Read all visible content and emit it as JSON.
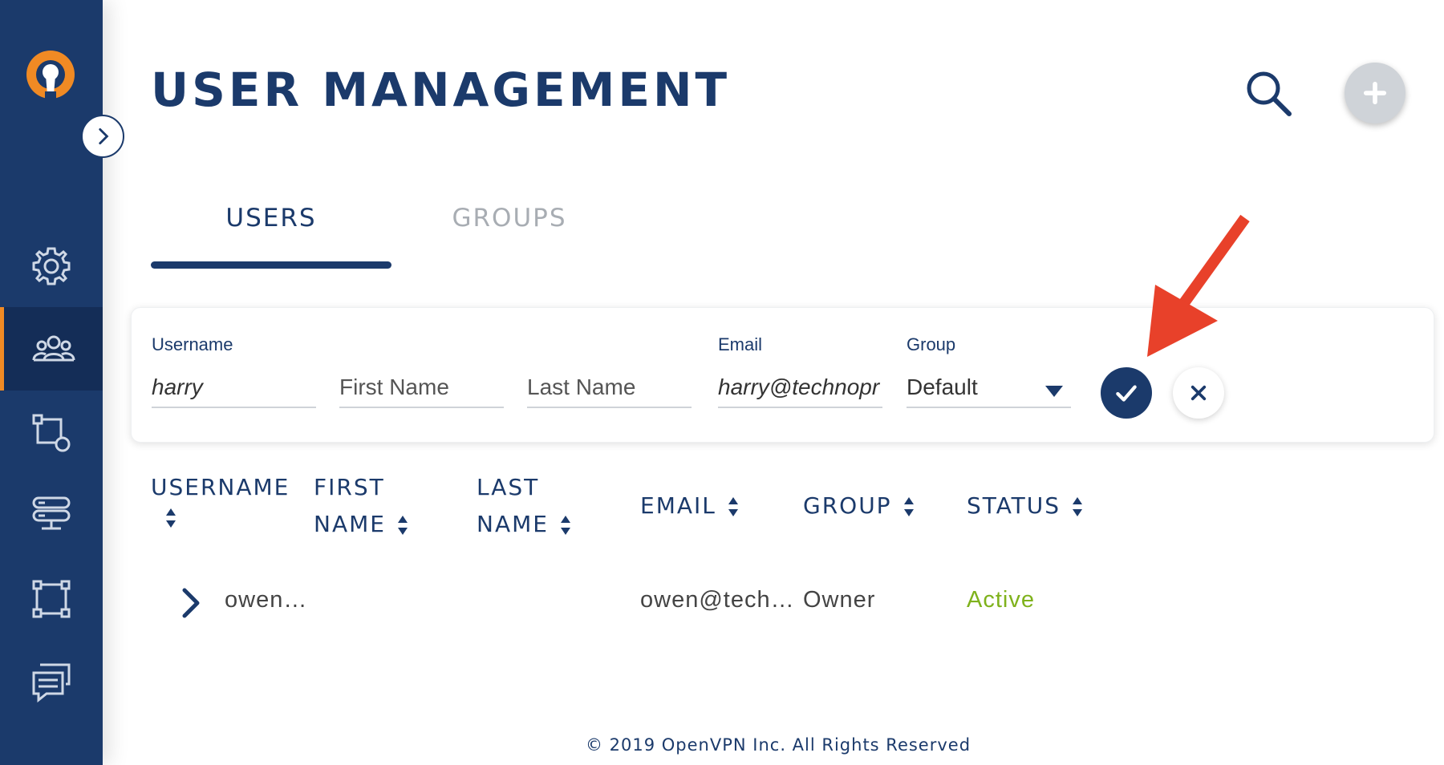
{
  "colors": {
    "brand_navy": "#1b3a6b",
    "accent_orange": "#f08a24",
    "status_active": "#7fb21c",
    "inactive_tab": "#a8adb3",
    "annotation_red": "#e8412a"
  },
  "sidebar": {
    "logo_icon": "openvpn-logo-icon",
    "expand_icon": "chevron-right-icon",
    "items": [
      {
        "icon": "gear-icon",
        "active": false
      },
      {
        "icon": "users-icon",
        "active": true
      },
      {
        "icon": "transform-icon",
        "active": false
      },
      {
        "icon": "servers-icon",
        "active": false
      },
      {
        "icon": "network-nodes-icon",
        "active": false
      },
      {
        "icon": "chat-icon",
        "active": false
      }
    ]
  },
  "header": {
    "title": "USER MANAGEMENT",
    "search_icon": "search-icon",
    "add_icon": "plus-icon"
  },
  "tabs": [
    {
      "label": "USERS",
      "active": true
    },
    {
      "label": "GROUPS",
      "active": false
    }
  ],
  "new_user_form": {
    "username": {
      "label": "Username",
      "value": "harry",
      "placeholder": ""
    },
    "first_name": {
      "label": "",
      "value": "",
      "placeholder": "First Name"
    },
    "last_name": {
      "label": "",
      "value": "",
      "placeholder": "Last Name"
    },
    "email": {
      "label": "Email",
      "value": "harry@technopr",
      "placeholder": ""
    },
    "group": {
      "label": "Group",
      "value": "Default"
    },
    "confirm_icon": "checkmark-icon",
    "cancel_icon": "close-icon"
  },
  "table": {
    "columns": [
      {
        "line1": "USERNAME",
        "line2": ""
      },
      {
        "line1": "FIRST",
        "line2": "NAME"
      },
      {
        "line1": "LAST",
        "line2": "NAME"
      },
      {
        "line1": "EMAIL",
        "line2": ""
      },
      {
        "line1": "GROUP",
        "line2": ""
      },
      {
        "line1": "STATUS",
        "line2": ""
      }
    ],
    "rows": [
      {
        "username": "owen…",
        "first_name": "",
        "last_name": "",
        "email": "owen@tech…",
        "group": "Owner",
        "status": "Active"
      }
    ]
  },
  "footer": {
    "copyright": "© 2019 OpenVPN Inc. All Rights Reserved"
  }
}
